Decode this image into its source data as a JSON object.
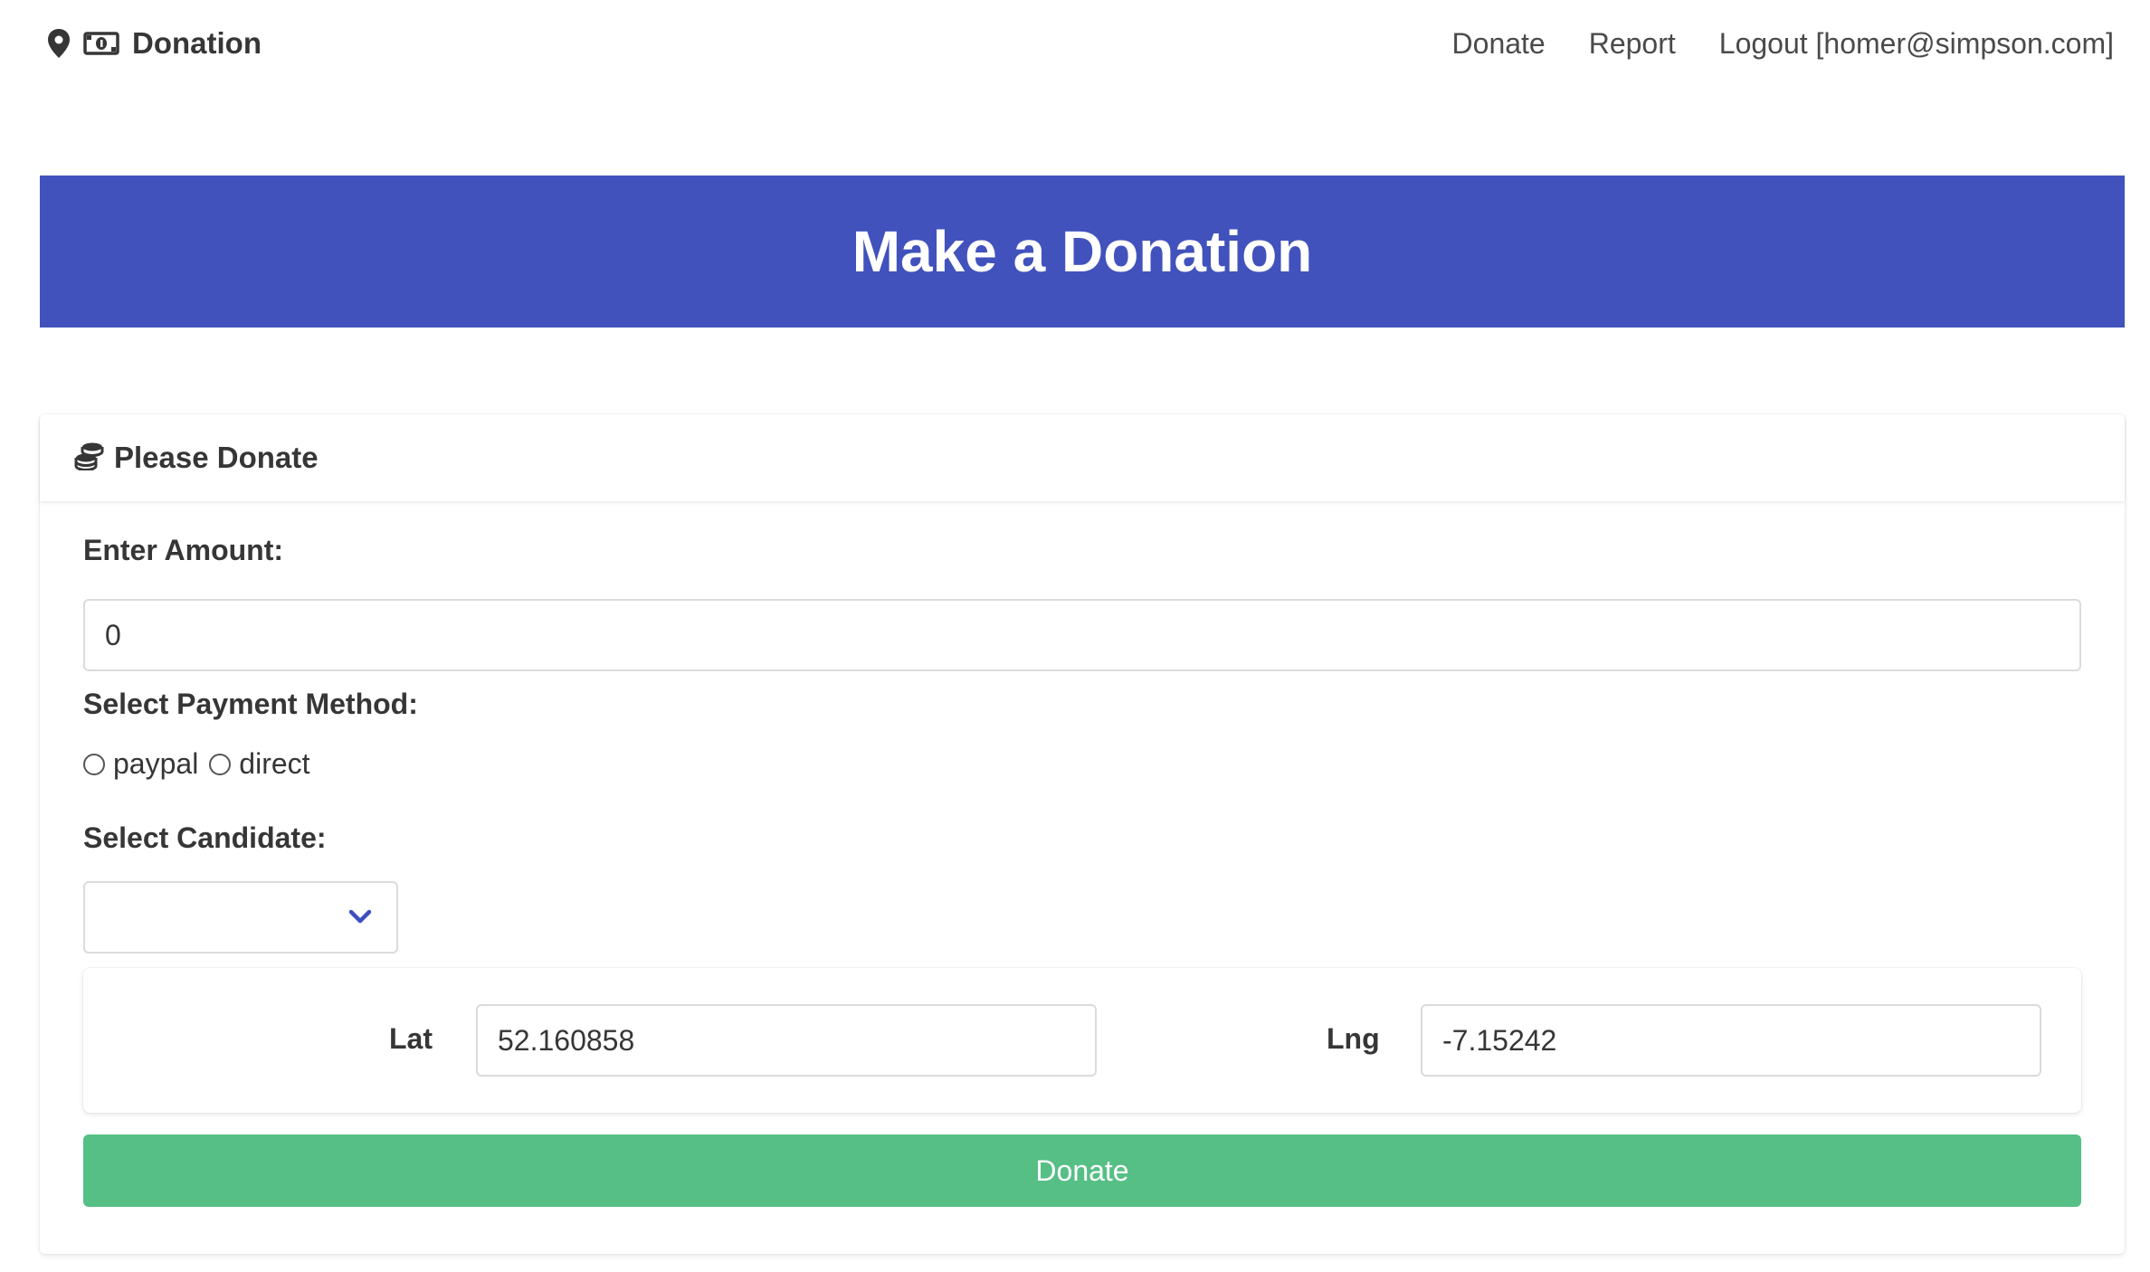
{
  "nav": {
    "brand": "Donation",
    "links": [
      "Donate",
      "Report",
      "Logout [homer@simpson.com]"
    ]
  },
  "hero": {
    "title": "Make a Donation"
  },
  "card": {
    "title": "Please Donate",
    "amount_label": "Enter Amount:",
    "amount_value": "0",
    "payment_label": "Select Payment Method:",
    "payment_options": [
      "paypal",
      "direct"
    ],
    "candidate_label": "Select Candidate:",
    "candidate_value": "",
    "lat_label": "Lat",
    "lat_value": "52.160858",
    "lng_label": "Lng",
    "lng_value": "-7.15242",
    "submit_label": "Donate"
  },
  "colors": {
    "hero": "#4152bd",
    "button": "#56bf85",
    "chevron": "#3e4fbf"
  }
}
